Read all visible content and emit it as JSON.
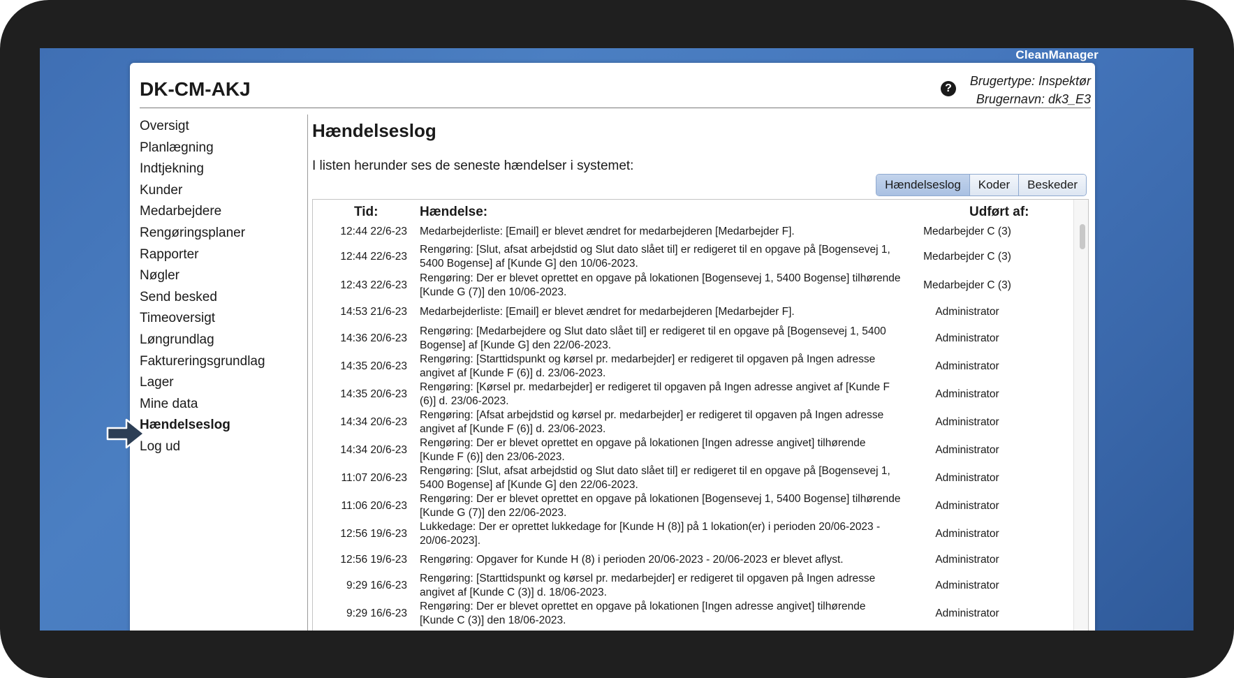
{
  "brand": "CleanManager",
  "header": {
    "site_title": "DK-CM-AKJ",
    "help_icon": "question-circle-icon",
    "user_type": "Brugertype: Inspektør",
    "user_name": "Brugernavn: dk3_E3"
  },
  "nav": {
    "items": [
      {
        "label": "Oversigt"
      },
      {
        "label": "Planlægning"
      },
      {
        "label": "Indtjekning"
      },
      {
        "label": "Kunder"
      },
      {
        "label": "Medarbejdere"
      },
      {
        "label": "Rengøringsplaner"
      },
      {
        "label": "Rapporter"
      },
      {
        "label": "Nøgler"
      },
      {
        "label": "Send besked"
      },
      {
        "label": "Timeoversigt"
      },
      {
        "label": "Løngrundlag"
      },
      {
        "label": "Faktureringsgrundlag"
      },
      {
        "label": "Lager"
      },
      {
        "label": "Mine data"
      },
      {
        "label": "Hændelseslog",
        "active": true
      },
      {
        "label": "Log ud"
      }
    ],
    "pointer_icon": "arrow-right-icon"
  },
  "main": {
    "title": "Hændelseslog",
    "intro": "I listen herunder ses de seneste hændelser i systemet:",
    "tabs": [
      {
        "label": "Hændelseslog",
        "active": true
      },
      {
        "label": "Koder"
      },
      {
        "label": "Beskeder"
      }
    ]
  },
  "log": {
    "columns": {
      "time": "Tid:",
      "event": "Hændelse:",
      "by": "Udført af:"
    },
    "rows": [
      {
        "time": "12:44 22/6-23",
        "event": "Medarbejderliste: [Email] er blevet ændret for medarbejderen [Medarbejder F].",
        "by": "Medarbejder C (3)"
      },
      {
        "time": "12:44 22/6-23",
        "event": "Rengøring: [Slut, afsat arbejdstid og Slut dato slået til] er redigeret til en opgave på [Bogensevej 1, 5400 Bogense] af [Kunde G] den 10/06-2023.",
        "by": "Medarbejder C (3)"
      },
      {
        "time": "12:43 22/6-23",
        "event": "Rengøring: Der er blevet oprettet en opgave på lokationen [Bogensevej 1, 5400 Bogense] tilhørende [Kunde G (7)] den 10/06-2023.",
        "by": "Medarbejder C (3)"
      },
      {
        "time": "14:53 21/6-23",
        "event": "Medarbejderliste: [Email] er blevet ændret for medarbejderen [Medarbejder F].",
        "by": "Administrator"
      },
      {
        "time": "14:36 20/6-23",
        "event": "Rengøring: [Medarbejdere og Slut dato slået til] er redigeret til en opgave på [Bogensevej 1, 5400 Bogense] af [Kunde G] den 22/06-2023.",
        "by": "Administrator"
      },
      {
        "time": "14:35 20/6-23",
        "event": "Rengøring: [Starttidspunkt og kørsel pr. medarbejder] er redigeret til opgaven på Ingen adresse angivet af [Kunde F (6)] d. 23/06-2023.",
        "by": "Administrator"
      },
      {
        "time": "14:35 20/6-23",
        "event": "Rengøring: [Kørsel pr. medarbejder] er redigeret til opgaven på Ingen adresse angivet af [Kunde F (6)] d. 23/06-2023.",
        "by": "Administrator"
      },
      {
        "time": "14:34 20/6-23",
        "event": "Rengøring: [Afsat arbejdstid og kørsel pr. medarbejder] er redigeret til opgaven på Ingen adresse angivet af [Kunde F (6)] d. 23/06-2023.",
        "by": "Administrator"
      },
      {
        "time": "14:34 20/6-23",
        "event": "Rengøring: Der er blevet oprettet en opgave på lokationen [Ingen adresse angivet] tilhørende [Kunde F (6)] den 23/06-2023.",
        "by": "Administrator"
      },
      {
        "time": "11:07 20/6-23",
        "event": "Rengøring: [Slut, afsat arbejdstid og Slut dato slået til] er redigeret til en opgave på [Bogensevej 1, 5400 Bogense] af [Kunde G] den 22/06-2023.",
        "by": "Administrator"
      },
      {
        "time": "11:06 20/6-23",
        "event": "Rengøring: Der er blevet oprettet en opgave på lokationen [Bogensevej 1, 5400 Bogense] tilhørende [Kunde G (7)] den 22/06-2023.",
        "by": "Administrator"
      },
      {
        "time": "12:56 19/6-23",
        "event": "Lukkedage: Der er oprettet lukkedage for [Kunde H (8)] på 1 lokation(er) i perioden 20/06-2023 - 20/06-2023].",
        "by": "Administrator"
      },
      {
        "time": "12:56 19/6-23",
        "event": "Rengøring: Opgaver for Kunde H (8) i perioden 20/06-2023 - 20/06-2023 er blevet aflyst.",
        "by": "Administrator"
      },
      {
        "time": "9:29 16/6-23",
        "event": "Rengøring: [Starttidspunkt og kørsel pr. medarbejder] er redigeret til opgaven på Ingen adresse angivet af [Kunde C (3)] d. 18/06-2023.",
        "by": "Administrator"
      },
      {
        "time": "9:29 16/6-23",
        "event": "Rengøring: Der er blevet oprettet en opgave på lokationen [Ingen adresse angivet] tilhørende [Kunde C (3)] den 18/06-2023.",
        "by": "Administrator"
      }
    ]
  }
}
